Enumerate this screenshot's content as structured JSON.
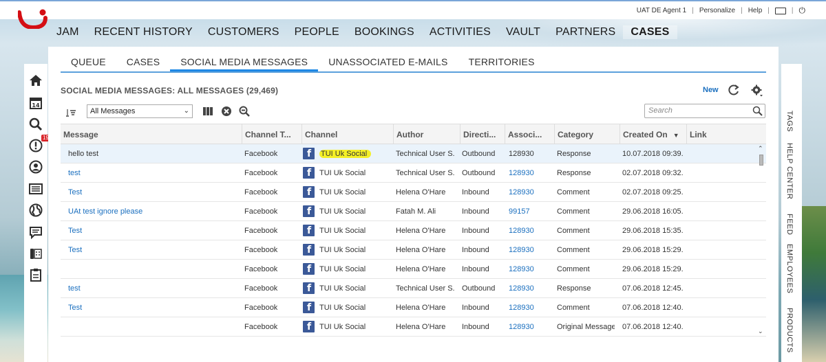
{
  "topbar": {
    "user": "UAT DE Agent 1",
    "personalize": "Personalize",
    "help": "Help"
  },
  "mainnav": {
    "items": [
      "JAM",
      "RECENT HISTORY",
      "CUSTOMERS",
      "PEOPLE",
      "BOOKINGS",
      "ACTIVITIES",
      "VAULT",
      "PARTNERS",
      "CASES"
    ],
    "active": "CASES"
  },
  "sidebar": {
    "icons": [
      "home-icon",
      "calendar-icon",
      "search-icon",
      "alert-icon",
      "person-icon",
      "list-icon",
      "globe-icon",
      "chat-icon",
      "phone-icon",
      "clipboard-icon"
    ],
    "calendar_day": "14",
    "alert_badge": "19"
  },
  "rightbar": {
    "tabs": [
      "TAGS",
      "HELP CENTER",
      "FEED",
      "EMPLOYEES",
      "PRODUCTS"
    ]
  },
  "subtabs": {
    "items": [
      "QUEUE",
      "CASES",
      "SOCIAL MEDIA MESSAGES",
      "UNASSOCIATED E-MAILS",
      "TERRITORIES"
    ],
    "active": "SOCIAL MEDIA MESSAGES"
  },
  "list": {
    "title": "SOCIAL MEDIA MESSAGES: ALL MESSAGES (29,469)",
    "new_label": "New",
    "filter_value": "All Messages",
    "search_placeholder": "Search"
  },
  "table": {
    "columns": [
      "Message",
      "Channel T...",
      "Channel",
      "Author",
      "Directi...",
      "Associ...",
      "Category",
      "Created On",
      "Link"
    ],
    "rows": [
      {
        "message": "hello test",
        "message_link": false,
        "channel_type": "Facebook",
        "channel": "TUI Uk Social",
        "author": "Technical User S...",
        "direction": "Outbound",
        "associated": "128930",
        "assoc_link": false,
        "category": "Response",
        "created": "10.07.2018 09:39...",
        "selected": true,
        "highlight": true
      },
      {
        "message": "test",
        "message_link": true,
        "channel_type": "Facebook",
        "channel": "TUI Uk Social",
        "author": "Technical User S...",
        "direction": "Outbound",
        "associated": "128930",
        "assoc_link": true,
        "category": "Response",
        "created": "02.07.2018 09:32..."
      },
      {
        "message": "Test",
        "message_link": true,
        "channel_type": "Facebook",
        "channel": "TUI Uk Social",
        "author": "Helena O'Hare",
        "direction": "Inbound",
        "associated": "128930",
        "assoc_link": true,
        "category": "Comment",
        "created": "02.07.2018 09:25..."
      },
      {
        "message": "UAt test ignore please",
        "message_link": true,
        "channel_type": "Facebook",
        "channel": "TUI Uk Social",
        "author": "Fatah M. Ali",
        "direction": "Inbound",
        "associated": "99157",
        "assoc_link": true,
        "category": "Comment",
        "created": "29.06.2018 16:05..."
      },
      {
        "message": "Test",
        "message_link": true,
        "channel_type": "Facebook",
        "channel": "TUI Uk Social",
        "author": "Helena O'Hare",
        "direction": "Inbound",
        "associated": "128930",
        "assoc_link": true,
        "category": "Comment",
        "created": "29.06.2018 15:35..."
      },
      {
        "message": "Test",
        "message_link": true,
        "channel_type": "Facebook",
        "channel": "TUI Uk Social",
        "author": "Helena O'Hare",
        "direction": "Inbound",
        "associated": "128930",
        "assoc_link": true,
        "category": "Comment",
        "created": "29.06.2018 15:29..."
      },
      {
        "message": "",
        "message_link": false,
        "channel_type": "Facebook",
        "channel": "TUI Uk Social",
        "author": "Helena O'Hare",
        "direction": "Inbound",
        "associated": "128930",
        "assoc_link": true,
        "category": "Comment",
        "created": "29.06.2018 15:29..."
      },
      {
        "message": "test",
        "message_link": true,
        "channel_type": "Facebook",
        "channel": "TUI Uk Social",
        "author": "Technical User S...",
        "direction": "Outbound",
        "associated": "128930",
        "assoc_link": true,
        "category": "Response",
        "created": "07.06.2018 12:45..."
      },
      {
        "message": "Test",
        "message_link": true,
        "channel_type": "Facebook",
        "channel": "TUI Uk Social",
        "author": "Helena O'Hare",
        "direction": "Inbound",
        "associated": "128930",
        "assoc_link": true,
        "category": "Comment",
        "created": "07.06.2018 12:40..."
      },
      {
        "message": "",
        "message_link": false,
        "channel_type": "Facebook",
        "channel": "TUI Uk Social",
        "author": "Helena O'Hare",
        "direction": "Inbound",
        "associated": "128930",
        "assoc_link": true,
        "category": "Original Message",
        "created": "07.06.2018 12:40..."
      }
    ]
  },
  "colors": {
    "accent_blue": "#1e88e5",
    "link_blue": "#1a6fbf",
    "facebook": "#3b5998",
    "tui_red": "#d40e14",
    "highlight_yellow": "#f4f027",
    "badge_red": "#d9262b"
  }
}
